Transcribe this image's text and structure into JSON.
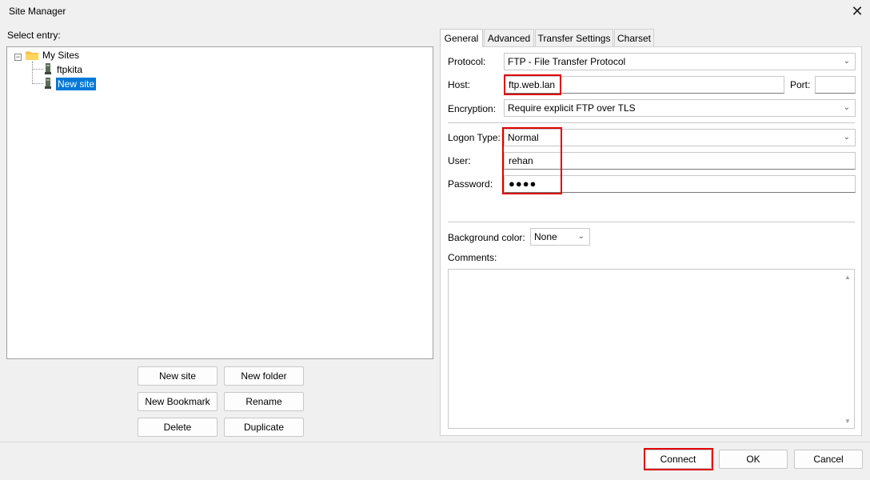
{
  "window": {
    "title": "Site Manager",
    "close_glyph": "✕"
  },
  "left": {
    "select_entry_label": "Select entry:",
    "tree": {
      "root": {
        "label": "My Sites",
        "icon": "folder-icon",
        "expanded": true
      },
      "children": [
        {
          "label": "ftpkita",
          "icon": "server-icon",
          "selected": false
        },
        {
          "label": "New site",
          "icon": "server-icon",
          "selected": true
        }
      ]
    },
    "buttons": {
      "new_site": "New site",
      "new_folder": "New folder",
      "new_bookmark": "New Bookmark",
      "rename": "Rename",
      "delete": "Delete",
      "duplicate": "Duplicate"
    }
  },
  "tabs": [
    {
      "label": "General",
      "active": true
    },
    {
      "label": "Advanced",
      "active": false
    },
    {
      "label": "Transfer Settings",
      "active": false
    },
    {
      "label": "Charset",
      "active": false
    }
  ],
  "general": {
    "protocol_label": "Protocol:",
    "protocol_value": "FTP - File Transfer Protocol",
    "host_label": "Host:",
    "host_value": "ftp.web.lan",
    "port_label": "Port:",
    "port_value": "",
    "encryption_label": "Encryption:",
    "encryption_value": "Require explicit FTP over TLS",
    "logon_type_label": "Logon Type:",
    "logon_type_value": "Normal",
    "user_label": "User:",
    "user_value": "rehan",
    "password_label": "Password:",
    "password_value": "●●●●",
    "background_color_label": "Background color:",
    "background_color_value": "None",
    "comments_label": "Comments:",
    "comments_value": ""
  },
  "footer": {
    "connect": "Connect",
    "ok": "OK",
    "cancel": "Cancel"
  },
  "colors": {
    "highlight_box": "#e00000",
    "selection": "#0078d7",
    "folder": "#f5c142"
  }
}
